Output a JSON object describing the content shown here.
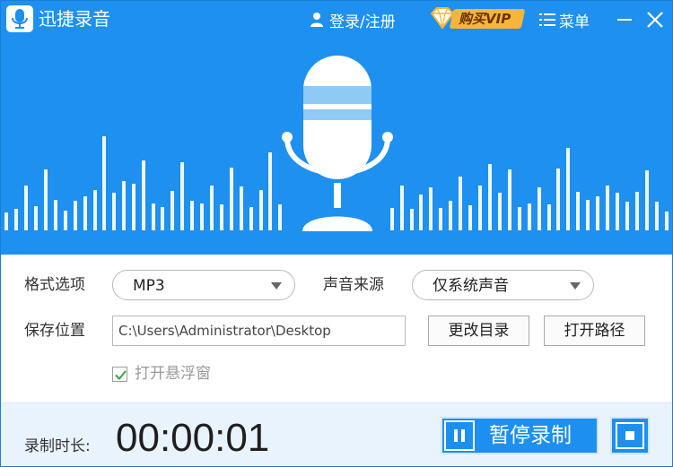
{
  "app": {
    "title": "迅捷录音",
    "logo_icon": "microphone-icon"
  },
  "titlebar": {
    "login_label": "登录/注册",
    "vip_label": "购买VIP",
    "menu_label": "菜单",
    "minimize_icon": "minimize-icon",
    "close_icon": "close-icon"
  },
  "settings": {
    "format_label": "格式选项",
    "format_value": "MP3",
    "source_label": "声音来源",
    "source_value": "仅系统声音",
    "save_label": "保存位置",
    "save_path": "C:\\Users\\Administrator\\Desktop",
    "change_dir_label": "更改目录",
    "open_path_label": "打开路径",
    "float_window_label": "打开悬浮窗",
    "float_window_checked": true
  },
  "status": {
    "duration_label": "录制时长:",
    "duration_value": "00:00:01",
    "pause_label": "暂停录制"
  },
  "colors": {
    "accent": "#1e90f0",
    "vip": "#f7b53b",
    "bottom_bg": "#e9f3fd"
  }
}
